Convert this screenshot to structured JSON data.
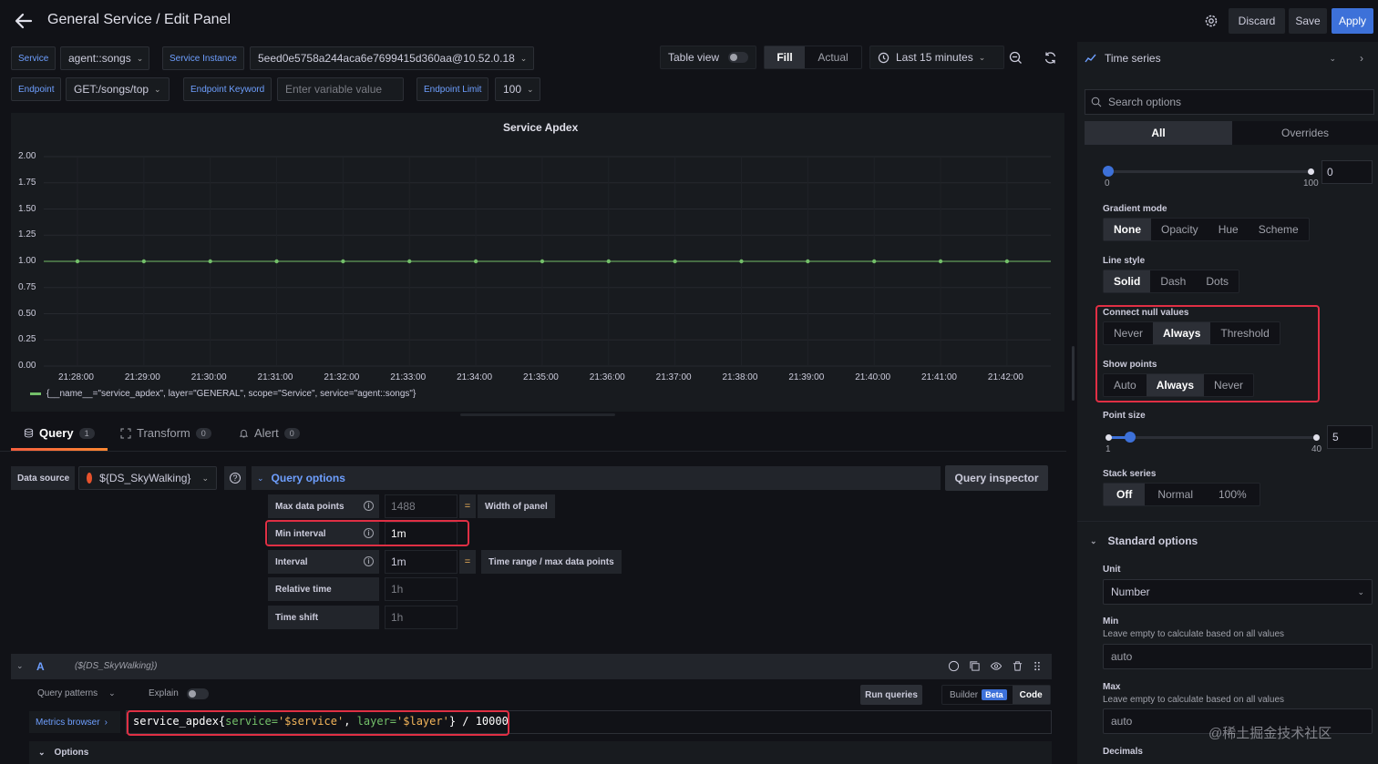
{
  "header": {
    "title": "General Service / Edit Panel",
    "discard": "Discard",
    "save": "Save",
    "apply": "Apply"
  },
  "variables": {
    "service_label": "Service",
    "service_value": "agent::songs",
    "instance_label": "Service Instance",
    "instance_value": "5eed0e5758a244aca6e7699415d360aa@10.52.0.18",
    "endpoint_label": "Endpoint",
    "endpoint_value": "GET:/songs/top",
    "keyword_label": "Endpoint Keyword",
    "keyword_placeholder": "Enter variable value",
    "limit_label": "Endpoint Limit",
    "limit_value": "100"
  },
  "toolbar": {
    "table_view": "Table view",
    "fill": "Fill",
    "actual": "Actual",
    "time_range": "Last 15 minutes"
  },
  "chart_data": {
    "type": "line",
    "title": "Service Apdex",
    "x": [
      "21:28:00",
      "21:29:00",
      "21:30:00",
      "21:31:00",
      "21:32:00",
      "21:33:00",
      "21:34:00",
      "21:35:00",
      "21:36:00",
      "21:37:00",
      "21:38:00",
      "21:39:00",
      "21:40:00",
      "21:41:00",
      "21:42:00"
    ],
    "series": [
      {
        "name": "{__name__=\"service_apdex\", layer=\"GENERAL\", scope=\"Service\", service=\"agent::songs\"}",
        "values": [
          1,
          1,
          1,
          1,
          1,
          1,
          1,
          1,
          1,
          1,
          1,
          1,
          1,
          1,
          1
        ],
        "color": "#73bf69"
      }
    ],
    "yticks": [
      "0.00",
      "0.25",
      "0.50",
      "0.75",
      "1.00",
      "1.25",
      "1.50",
      "1.75",
      "2.00"
    ],
    "ylim": [
      0,
      2
    ],
    "grid": true,
    "legend": "bottom-left"
  },
  "tabs": {
    "query": "Query",
    "query_count": "1",
    "transform": "Transform",
    "transform_count": "0",
    "alert": "Alert",
    "alert_count": "0"
  },
  "datasource": {
    "label": "Data source",
    "value": "${DS_SkyWalking}",
    "query_options": "Query options",
    "inspector": "Query inspector"
  },
  "query_options": {
    "max_points_label": "Max data points",
    "max_points_value": "1488",
    "width_of_panel": "Width of panel",
    "min_interval_label": "Min interval",
    "min_interval_value": "1m",
    "interval_label": "Interval",
    "interval_value": "1m",
    "interval_suffix": "Time range / max data points",
    "relative_time_label": "Relative time",
    "relative_time_placeholder": "1h",
    "time_shift_label": "Time shift",
    "time_shift_placeholder": "1h"
  },
  "query_row": {
    "letter": "A",
    "ds": "(${DS_SkyWalking})",
    "patterns": "Query patterns",
    "explain": "Explain",
    "run": "Run queries",
    "builder": "Builder",
    "beta": "Beta",
    "code": "Code",
    "metrics_browser": "Metrics browser",
    "expr_prefix": "service_apdex{",
    "expr_k1": "service=",
    "expr_v1": "'$service'",
    "expr_sep": ", ",
    "expr_k2": "layer=",
    "expr_v2": "'$layer'",
    "expr_suffix": "} / 10000",
    "options": "Options"
  },
  "right_panel": {
    "viz": "Time series",
    "search_placeholder": "Search options",
    "tab_all": "All",
    "tab_overrides": "Overrides",
    "fill_opacity": {
      "min": "0",
      "max": "100",
      "value": "0",
      "fraction": 0
    },
    "gradient_label": "Gradient mode",
    "gradient_opts": [
      "None",
      "Opacity",
      "Hue",
      "Scheme"
    ],
    "line_style_label": "Line style",
    "line_style_opts": [
      "Solid",
      "Dash",
      "Dots"
    ],
    "connect_label": "Connect null values",
    "connect_opts": [
      "Never",
      "Always",
      "Threshold"
    ],
    "show_points_label": "Show points",
    "show_points_opts": [
      "Auto",
      "Always",
      "Never"
    ],
    "point_size_label": "Point size",
    "point_size": {
      "min": "1",
      "max": "40",
      "value": "5",
      "fraction": 0.103
    },
    "stack_label": "Stack series",
    "stack_opts": [
      "Off",
      "Normal",
      "100%"
    ],
    "standard_options": "Standard options",
    "unit_label": "Unit",
    "unit_value": "Number",
    "min_label": "Min",
    "min_desc": "Leave empty to calculate based on all values",
    "min_placeholder": "auto",
    "max_label": "Max",
    "max_desc": "Leave empty to calculate based on all values",
    "max_placeholder": "auto",
    "decimals_label": "Decimals"
  },
  "watermark": "@稀土掘金技术社区"
}
